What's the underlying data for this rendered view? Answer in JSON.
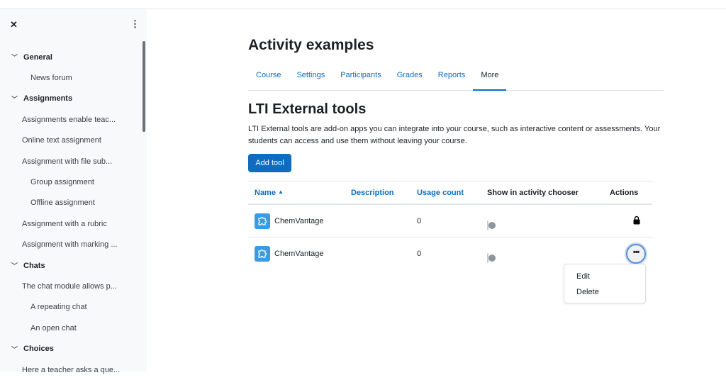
{
  "sidebar": {
    "items": [
      {
        "label": "General",
        "type": "section"
      },
      {
        "label": "News forum",
        "type": "l2"
      },
      {
        "label": "Assignments",
        "type": "section"
      },
      {
        "label": "Assignments enable teac...",
        "type": "l1"
      },
      {
        "label": "Online text assignment",
        "type": "l1"
      },
      {
        "label": "Assignment with file sub...",
        "type": "l1"
      },
      {
        "label": "Group assignment",
        "type": "l2"
      },
      {
        "label": "Offline assignment",
        "type": "l2"
      },
      {
        "label": "Assignment with a rubric",
        "type": "l1"
      },
      {
        "label": "Assignment with marking ...",
        "type": "l1"
      },
      {
        "label": "Chats",
        "type": "section"
      },
      {
        "label": "The chat module allows p...",
        "type": "l1"
      },
      {
        "label": "A repeating chat",
        "type": "l2"
      },
      {
        "label": "An open chat",
        "type": "l2"
      },
      {
        "label": "Choices",
        "type": "section"
      },
      {
        "label": "Here a teacher asks a que...",
        "type": "l1"
      }
    ]
  },
  "page": {
    "title": "Activity examples"
  },
  "tabs": [
    {
      "label": "Course"
    },
    {
      "label": "Settings"
    },
    {
      "label": "Participants"
    },
    {
      "label": "Grades"
    },
    {
      "label": "Reports"
    },
    {
      "label": "More",
      "active": true
    }
  ],
  "section": {
    "title": "LTI External tools",
    "description": "LTI External tools are add-on apps you can integrate into your course, such as interactive content or assessments. Your students can access and use them without leaving your course.",
    "add_label": "Add tool"
  },
  "table": {
    "headers": {
      "name": "Name",
      "description": "Description",
      "usage": "Usage count",
      "show": "Show in activity chooser",
      "actions": "Actions"
    },
    "sort": "name-ascending",
    "rows": [
      {
        "name": "ChemVantage",
        "description": "",
        "usage": "0",
        "show": false,
        "action": "lock-icon"
      },
      {
        "name": "ChemVantage",
        "description": "",
        "usage": "0",
        "show": false,
        "action": "more-icon"
      }
    ]
  },
  "menu": {
    "items": [
      "Edit",
      "Delete"
    ]
  },
  "colors": {
    "accent": "#0f6cbf",
    "sidebar_bg": "#f8f9fa",
    "tool_icon": "#399be2"
  }
}
